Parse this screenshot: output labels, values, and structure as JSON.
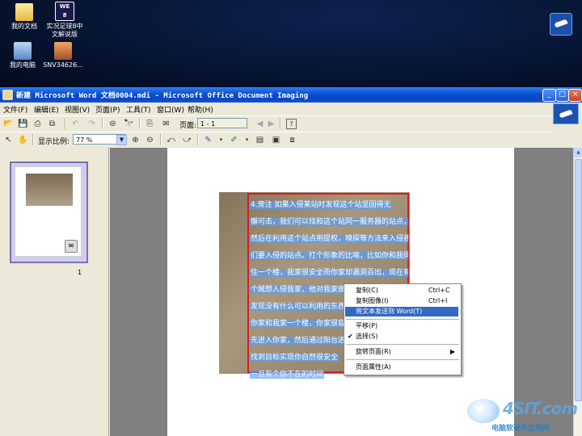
{
  "desktop": {
    "icons": [
      {
        "label": "我的文档",
        "icon": "folder-icon"
      },
      {
        "label": "实况足球8中\n文解说版",
        "icon": "game-icon"
      },
      {
        "label": "我的电脑",
        "icon": "computer-icon"
      },
      {
        "label": "SNV34626...",
        "icon": "image-file-icon"
      }
    ]
  },
  "window": {
    "title": "新建 Microsoft Word 文档0004.mdi - Microsoft Office Document Imaging",
    "controls": {
      "minimize": "_",
      "maximize": "□",
      "close": "×"
    }
  },
  "menubar": {
    "items": [
      "文件(F)",
      "编辑(E)",
      "视图(V)",
      "页面(P)",
      "工具(T)",
      "窗口(W)",
      "帮助(H)"
    ]
  },
  "toolbar": {
    "page_label": "页面:",
    "page_value": "1 - 1",
    "zoom_label": "显示比例:",
    "zoom_value": "77 %"
  },
  "thumbnail": {
    "page_number": "1"
  },
  "document": {
    "lines": [
      "4.旁注 如果入侵某站时发现这个站坚固得无",
      "懈可击，我们可以找和这个站同一服务器的站点，",
      "然后在利用这个站点用提权，嗅探等方法来入侵我",
      "们要入侵的站点。打个形象的比喻，比如你和我同",
      "住一个楼，我家很安全而你家却漏洞百出，现在有",
      "个贼想入侵我家，他对我家做了监视(也就是扫描)",
      "发现没有什么可以利用的东西，那么这个贼发现",
      "你家和我家一个楼，你家很容易就进去了，他可以",
      "先进入你家，然后通过阳台进入我家",
      "找到目标实现你自然很安全",
      "一旦有个你不在的时间"
    ]
  },
  "context_menu": {
    "items": [
      {
        "label": "复制(C)",
        "shortcut": "Ctrl+C"
      },
      {
        "label": "复制图像(I)",
        "shortcut": "Ctrl+I"
      },
      {
        "label": "将文本发送到 Word(T)",
        "shortcut": "",
        "highlighted": true
      },
      {
        "label": "平移(P)",
        "shortcut": ""
      },
      {
        "label": "选择(S)",
        "shortcut": "",
        "checked": true
      },
      {
        "label": "旋转页面(R)",
        "shortcut": "",
        "submenu": true
      },
      {
        "label": "页面属性(A)",
        "shortcut": ""
      }
    ]
  },
  "watermark": {
    "brand": "4SIT.com",
    "subtitle": "电脑软硬件应用网"
  }
}
